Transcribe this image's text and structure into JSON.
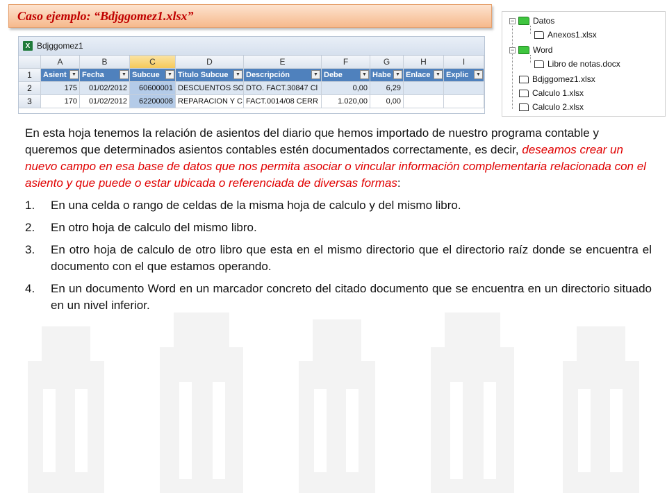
{
  "title": "Caso ejemplo: “Bdjggomez1.xlsx”",
  "spreadsheet": {
    "window_title": "Bdjggomez1",
    "columns": [
      "A",
      "B",
      "C",
      "D",
      "E",
      "F",
      "G",
      "H",
      "I"
    ],
    "selected_column": "C",
    "row_numbers": [
      "1",
      "2",
      "3"
    ],
    "fields": [
      "Asient",
      "Fecha",
      "Subcue",
      "Titulo Subcue",
      "Descripción",
      "Debe",
      "Habe",
      "Enlace",
      "Explic"
    ],
    "rows": [
      [
        "175",
        "01/02/2012",
        "60600001",
        "DESCUENTOS SO",
        "DTO. FACT.30847 Cl",
        "0,00",
        "6,29",
        "",
        ""
      ],
      [
        "170",
        "01/02/2012",
        "62200008",
        "REPARACION Y C",
        "FACT.0014/08 CERR",
        "1.020,00",
        "0,00",
        "",
        ""
      ]
    ]
  },
  "file_tree": {
    "nodes": [
      {
        "label": "Datos",
        "type": "folder"
      },
      {
        "label": "Anexos1.xlsx",
        "type": "file"
      },
      {
        "label": "Word",
        "type": "folder"
      },
      {
        "label": "Libro de notas.docx",
        "type": "file"
      },
      {
        "label": "Bdjggomez1.xlsx",
        "type": "file"
      },
      {
        "label": "Calculo 1.xlsx",
        "type": "file"
      },
      {
        "label": "Calculo 2.xlsx",
        "type": "file"
      }
    ]
  },
  "intro": {
    "part1": "En esta hoja tenemos la relación de asientos del diario que hemos importado de nuestro programa contable y queremos que determinados asientos contables estén documentados correctamente, es decir, ",
    "highlight": "deseamos crear un nuevo campo en esa base de datos que nos permita asociar o vincular información complementaria relacionada con el asiento y que puede o estar ubicada o referenciada de diversas formas",
    "part2": ":"
  },
  "list": [
    {
      "num": "1.",
      "text": "En una celda o rango de celdas de la misma hoja de calculo y del mismo libro."
    },
    {
      "num": "2.",
      "text": "En otro hoja de calculo del mismo libro."
    },
    {
      "num": "3.",
      "text": "En otro hoja de calculo de otro libro que esta en el mismo directorio que el directorio raíz donde se encuentra el documento con el que estamos operando."
    },
    {
      "num": "4.",
      "text": "En un documento Word en un marcador concreto del citado documento que se encuentra en un directorio situado en un nivel inferior."
    }
  ],
  "colors": {
    "title_text": "#c00000",
    "highlight_text": "#e00000",
    "table_header": "#4f81bd",
    "folder": "#3fc53f"
  }
}
